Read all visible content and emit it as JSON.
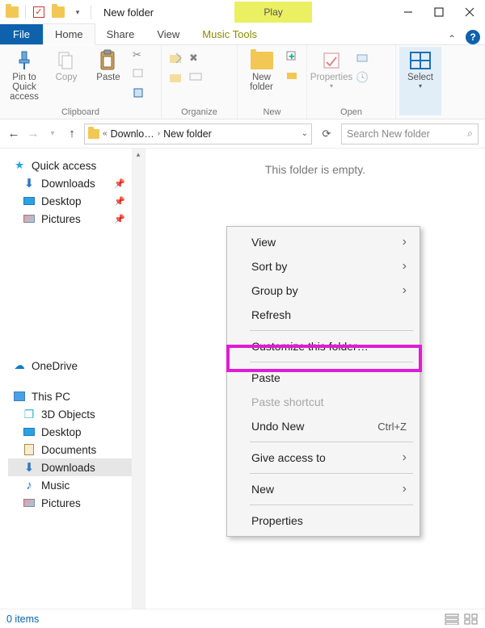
{
  "window": {
    "title": "New folder",
    "contextual_tab": "Play"
  },
  "tabs": {
    "file": "File",
    "home": "Home",
    "share": "Share",
    "view": "View",
    "music": "Music Tools"
  },
  "ribbon": {
    "pin": "Pin to Quick\naccess",
    "copy": "Copy",
    "paste": "Paste",
    "newfolder": "New\nfolder",
    "properties": "Properties",
    "select": "Select",
    "group_clipboard": "Clipboard",
    "group_organize": "Organize",
    "group_new": "New",
    "group_open": "Open",
    "group_select": ""
  },
  "address": {
    "crumb1": "Downlo…",
    "crumb2": "New folder"
  },
  "search": {
    "placeholder": "Search New folder"
  },
  "empty": "This folder is empty.",
  "nav": {
    "quick": "Quick access",
    "downloads": "Downloads",
    "desktop": "Desktop",
    "pictures": "Pictures",
    "onedrive": "OneDrive",
    "thispc": "This PC",
    "objects3d": "3D Objects",
    "desktop2": "Desktop",
    "documents": "Documents",
    "downloads2": "Downloads",
    "music": "Music",
    "pictures2": "Pictures"
  },
  "context": {
    "view": "View",
    "sortby": "Sort by",
    "groupby": "Group by",
    "refresh": "Refresh",
    "customize": "Customize this folder…",
    "paste": "Paste",
    "paste_shortcut": "Paste shortcut",
    "undo": "Undo New",
    "undo_hotkey": "Ctrl+Z",
    "giveaccess": "Give access to",
    "new": "New",
    "properties": "Properties"
  },
  "status": {
    "items": "0 items"
  }
}
